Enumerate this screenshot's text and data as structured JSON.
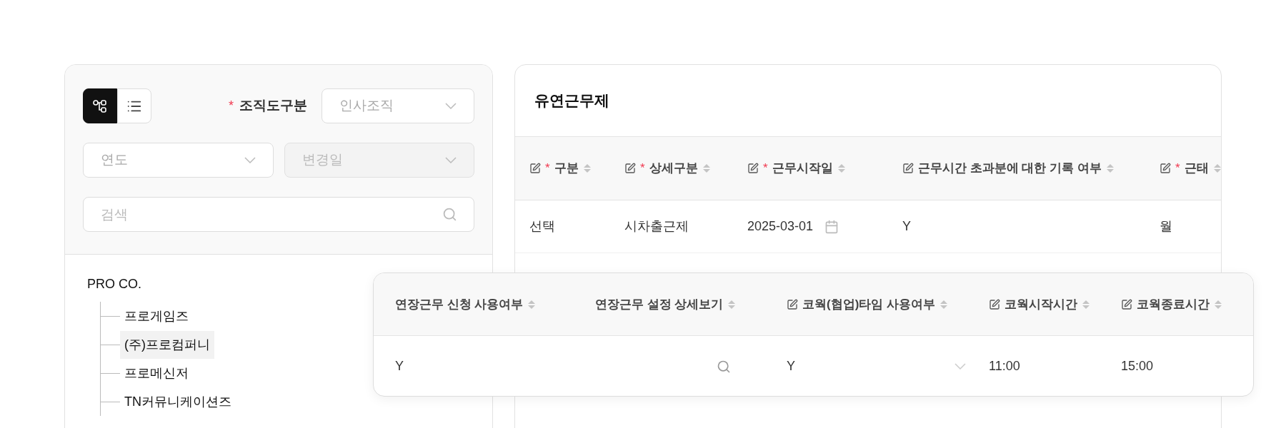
{
  "org_panel": {
    "view_toggle": [
      {
        "kind": "tree",
        "selected": true
      },
      {
        "kind": "list",
        "selected": false
      }
    ],
    "chart_type": {
      "mark": "*",
      "label": "조직도구분",
      "placeholder": "인사조직"
    },
    "year": {
      "placeholder": "연도",
      "disabled": false
    },
    "change_date": {
      "placeholder": "변경일",
      "disabled": true
    },
    "search": {
      "placeholder": "검색"
    },
    "tree": {
      "label": "PRO CO.",
      "children": [
        {
          "label": "프로게임즈",
          "selected": false
        },
        {
          "label": "(주)프로컴퍼니",
          "selected": true
        },
        {
          "label": "프로메신저",
          "selected": false
        },
        {
          "label": "TN커뮤니케이션즈",
          "selected": false
        }
      ]
    }
  },
  "flex_work": {
    "title": "유연근무제",
    "columns": [
      {
        "label": "구분",
        "editable": true,
        "mark": "*"
      },
      {
        "label": "상세구분",
        "editable": true,
        "mark": "*"
      },
      {
        "label": "근무시작일",
        "editable": true,
        "mark": "*"
      },
      {
        "label": "근무시간 초과분에 대한 기록 여부",
        "editable": true
      },
      {
        "label": "근태",
        "editable": true,
        "mark": "*"
      }
    ],
    "rows": [
      {
        "cells": [
          {
            "kind": "text",
            "value": "선택"
          },
          {
            "kind": "text",
            "value": "시차출근제"
          },
          {
            "kind": "date",
            "value": "2025-03-01"
          },
          {
            "kind": "text",
            "value": "Y"
          },
          {
            "kind": "text",
            "value": "월"
          }
        ]
      }
    ]
  },
  "overtime_card": {
    "columns": [
      {
        "label": "연장근무 신청 사용여부",
        "editable": false
      },
      {
        "label": "연장근무 설정 상세보기",
        "editable": false
      },
      {
        "label": "코웍(협업)타임 사용여부",
        "editable": true
      },
      {
        "label": "코웍시작시간",
        "editable": true
      },
      {
        "label": "코웍종료시간",
        "editable": true
      }
    ],
    "rows": [
      {
        "cells": [
          {
            "kind": "text",
            "value": "Y"
          },
          {
            "kind": "search"
          },
          {
            "kind": "select",
            "value": "Y"
          },
          {
            "kind": "text",
            "value": "11:00"
          },
          {
            "kind": "text",
            "value": "15:00"
          }
        ]
      }
    ]
  }
}
